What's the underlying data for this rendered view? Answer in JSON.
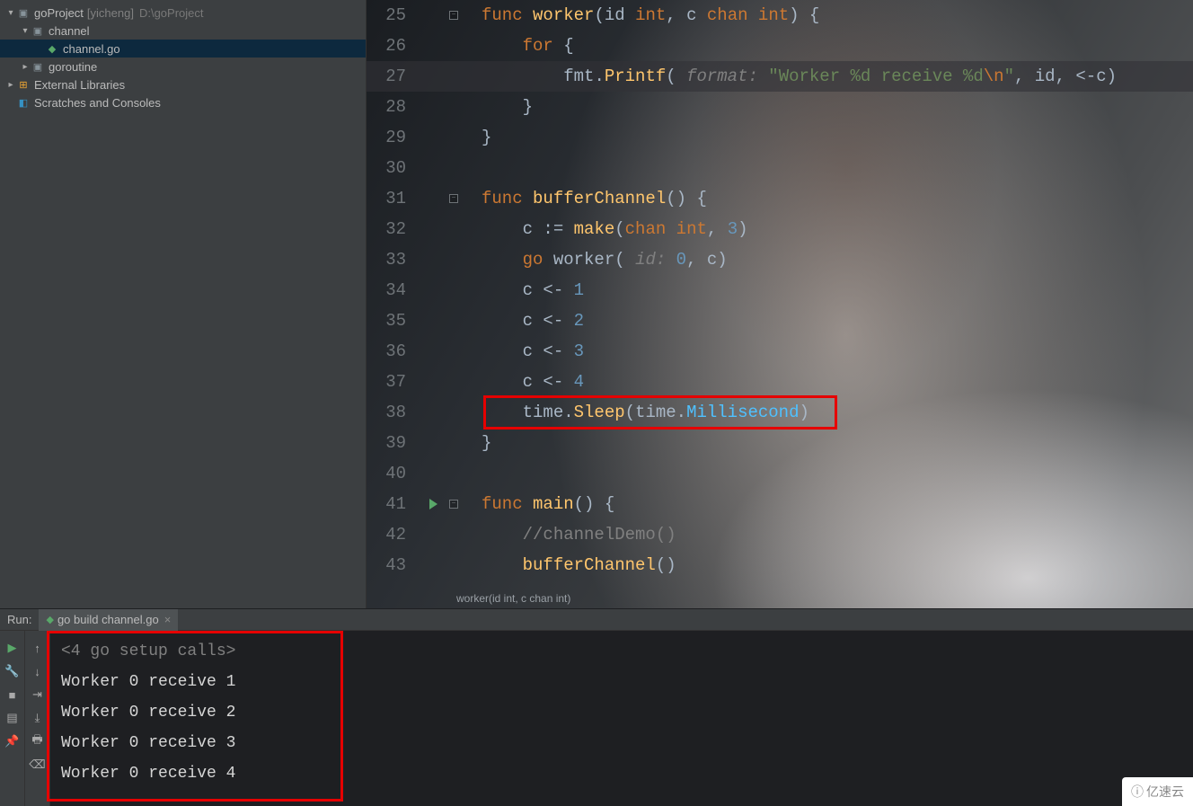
{
  "project": {
    "root_name": "goProject",
    "root_tag": "[yicheng]",
    "root_path": "D:\\goProject",
    "items": [
      {
        "name": "channel",
        "type": "folder",
        "indent": 1,
        "expanded": true
      },
      {
        "name": "channel.go",
        "type": "gofile",
        "indent": 2,
        "selected": true
      },
      {
        "name": "goroutine",
        "type": "folder",
        "indent": 1,
        "expanded": false
      }
    ],
    "external_libs": "External Libraries",
    "scratches": "Scratches and Consoles"
  },
  "code_lines": [
    {
      "num": 25,
      "fold": "-",
      "tokens": [
        [
          "kw",
          "func "
        ],
        [
          "fn",
          "worker"
        ],
        [
          "op",
          "("
        ],
        [
          "txt",
          "id "
        ],
        [
          "kw",
          "int"
        ],
        [
          "op",
          ", "
        ],
        [
          "txt",
          "c "
        ],
        [
          "kw",
          "chan int"
        ],
        [
          "op",
          ") {"
        ]
      ]
    },
    {
      "num": 26,
      "tokens": [
        [
          "txt",
          "    "
        ],
        [
          "kw",
          "for"
        ],
        [
          "op",
          " {"
        ]
      ]
    },
    {
      "num": 27,
      "hl": true,
      "tokens": [
        [
          "txt",
          "        "
        ],
        [
          "txt",
          "fmt"
        ],
        [
          "op",
          "."
        ],
        [
          "yellow",
          "Printf"
        ],
        [
          "op",
          "( "
        ],
        [
          "param",
          "format: "
        ],
        [
          "str",
          "\"Worker %d receive %d"
        ],
        [
          "esc",
          "\\n"
        ],
        [
          "str",
          "\""
        ],
        [
          "op",
          ", "
        ],
        [
          "txt",
          "id"
        ],
        [
          "op",
          ", "
        ],
        [
          "op",
          "<-"
        ],
        [
          "txt",
          "c"
        ],
        [
          "op",
          ")"
        ]
      ]
    },
    {
      "num": 28,
      "tokens": [
        [
          "txt",
          "    "
        ],
        [
          "op",
          "}"
        ]
      ]
    },
    {
      "num": 29,
      "fold": "e",
      "tokens": [
        [
          "op",
          "}"
        ]
      ]
    },
    {
      "num": 30,
      "tokens": []
    },
    {
      "num": 31,
      "fold": "-",
      "tokens": [
        [
          "kw",
          "func "
        ],
        [
          "fn",
          "bufferChannel"
        ],
        [
          "op",
          "() {"
        ]
      ]
    },
    {
      "num": 32,
      "tokens": [
        [
          "txt",
          "    "
        ],
        [
          "txt",
          "c "
        ],
        [
          "op",
          ":= "
        ],
        [
          "yellow",
          "make"
        ],
        [
          "op",
          "("
        ],
        [
          "kw",
          "chan int"
        ],
        [
          "op",
          ", "
        ],
        [
          "num",
          "3"
        ],
        [
          "op",
          ")"
        ]
      ]
    },
    {
      "num": 33,
      "tokens": [
        [
          "txt",
          "    "
        ],
        [
          "kw",
          "go "
        ],
        [
          "txt",
          "worker"
        ],
        [
          "op",
          "( "
        ],
        [
          "param",
          "id: "
        ],
        [
          "num",
          "0"
        ],
        [
          "op",
          ", "
        ],
        [
          "txt",
          "c"
        ],
        [
          "op",
          ")"
        ]
      ]
    },
    {
      "num": 34,
      "tokens": [
        [
          "txt",
          "    "
        ],
        [
          "txt",
          "c "
        ],
        [
          "op",
          "<- "
        ],
        [
          "num",
          "1"
        ]
      ]
    },
    {
      "num": 35,
      "tokens": [
        [
          "txt",
          "    "
        ],
        [
          "txt",
          "c "
        ],
        [
          "op",
          "<- "
        ],
        [
          "num",
          "2"
        ]
      ]
    },
    {
      "num": 36,
      "tokens": [
        [
          "txt",
          "    "
        ],
        [
          "txt",
          "c "
        ],
        [
          "op",
          "<- "
        ],
        [
          "num",
          "3"
        ]
      ]
    },
    {
      "num": 37,
      "tokens": [
        [
          "txt",
          "    "
        ],
        [
          "txt",
          "c "
        ],
        [
          "op",
          "<- "
        ],
        [
          "num",
          "4"
        ]
      ]
    },
    {
      "num": 38,
      "tokens": [
        [
          "txt",
          "    "
        ],
        [
          "txt",
          "time"
        ],
        [
          "op",
          "."
        ],
        [
          "yellow",
          "Sleep"
        ],
        [
          "op",
          "("
        ],
        [
          "txt",
          "time"
        ],
        [
          "op",
          "."
        ],
        [
          "cyan",
          "Millisecond"
        ],
        [
          "op",
          ")"
        ]
      ]
    },
    {
      "num": 39,
      "fold": "e",
      "tokens": [
        [
          "op",
          "}"
        ]
      ]
    },
    {
      "num": 40,
      "tokens": []
    },
    {
      "num": 41,
      "run": true,
      "fold": "-",
      "tokens": [
        [
          "kw",
          "func "
        ],
        [
          "fn",
          "main"
        ],
        [
          "op",
          "() {"
        ]
      ]
    },
    {
      "num": 42,
      "tokens": [
        [
          "txt",
          "    "
        ],
        [
          "comment",
          "//channelDemo()"
        ]
      ]
    },
    {
      "num": 43,
      "tokens": [
        [
          "txt",
          "    "
        ],
        [
          "fn",
          "bufferChannel"
        ],
        [
          "op",
          "()"
        ]
      ]
    }
  ],
  "breadcrumb": "worker(id int, c chan int)",
  "highlight_box": {
    "line": 38
  },
  "run": {
    "label": "Run:",
    "tab": "go build channel.go",
    "console": [
      "<4 go setup calls>",
      "Worker 0 receive 1",
      "Worker 0 receive 2",
      "Worker 0 receive 3",
      "Worker 0 receive 4"
    ]
  },
  "watermark": "亿速云"
}
